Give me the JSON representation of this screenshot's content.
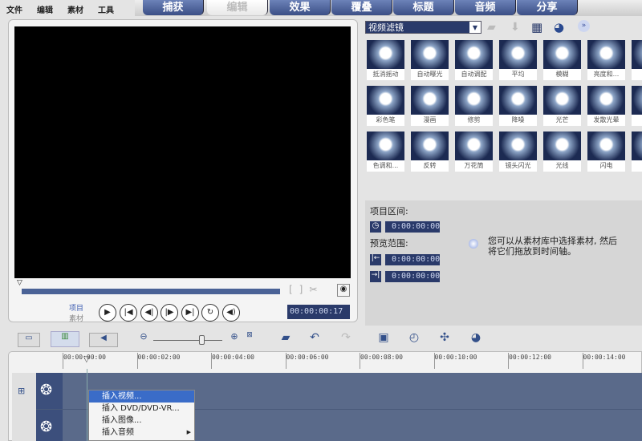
{
  "menu": [
    "文件",
    "编辑",
    "素材",
    "工具"
  ],
  "tabs": [
    {
      "label": "捕获"
    },
    {
      "label": "编辑",
      "active": true
    },
    {
      "label": "效果"
    },
    {
      "label": "覆叠"
    },
    {
      "label": "标题"
    },
    {
      "label": "音频"
    },
    {
      "label": "分享"
    }
  ],
  "library": {
    "dropdown": "视频滤镜",
    "icons": [
      "folder-icon",
      "import-icon",
      "options-icon",
      "library-manager-icon",
      "expand-icon"
    ],
    "rows": [
      [
        "抵消摇动",
        "自动曝光",
        "自动调配",
        "平均",
        "模糊",
        "亮度和...",
        ""
      ],
      [
        "彩色笔",
        "漫画",
        "修剪",
        "降噪",
        "光芒",
        "发散光晕",
        ""
      ],
      [
        "色调和...",
        "反转",
        "万花筒",
        "镜头闪光",
        "光线",
        "闪电",
        ""
      ]
    ]
  },
  "preview": {
    "mode_project": "项目",
    "mode_clip": "素材",
    "timecode": "00:00:00:17",
    "progress": 0
  },
  "info": {
    "duration_label": "项目区间:",
    "duration": "0:00:00:00",
    "preview_label": "预览范围:",
    "start": "0:00:00:00",
    "end": "0:00:00:00",
    "hint": "您可以从素材库中选择素材, 然后将它们拖放到时间轴。"
  },
  "timeline": {
    "ticks": [
      "00:00:00:00",
      "00:00:02:00",
      "00:00:04:00",
      "00:00:06:00",
      "00:00:08:00",
      "00:00:10:00",
      "00:00:12:00",
      "00:00:14:00"
    ],
    "zoom_level": 0.5
  },
  "context_menu": [
    "插入视频...",
    "插入 DVD/DVD-VR...",
    "插入图像...",
    "插入音频"
  ],
  "colors": {
    "accent": "#3b4f86",
    "track": "#5a6a8a",
    "selection": "#3a6cc8"
  }
}
